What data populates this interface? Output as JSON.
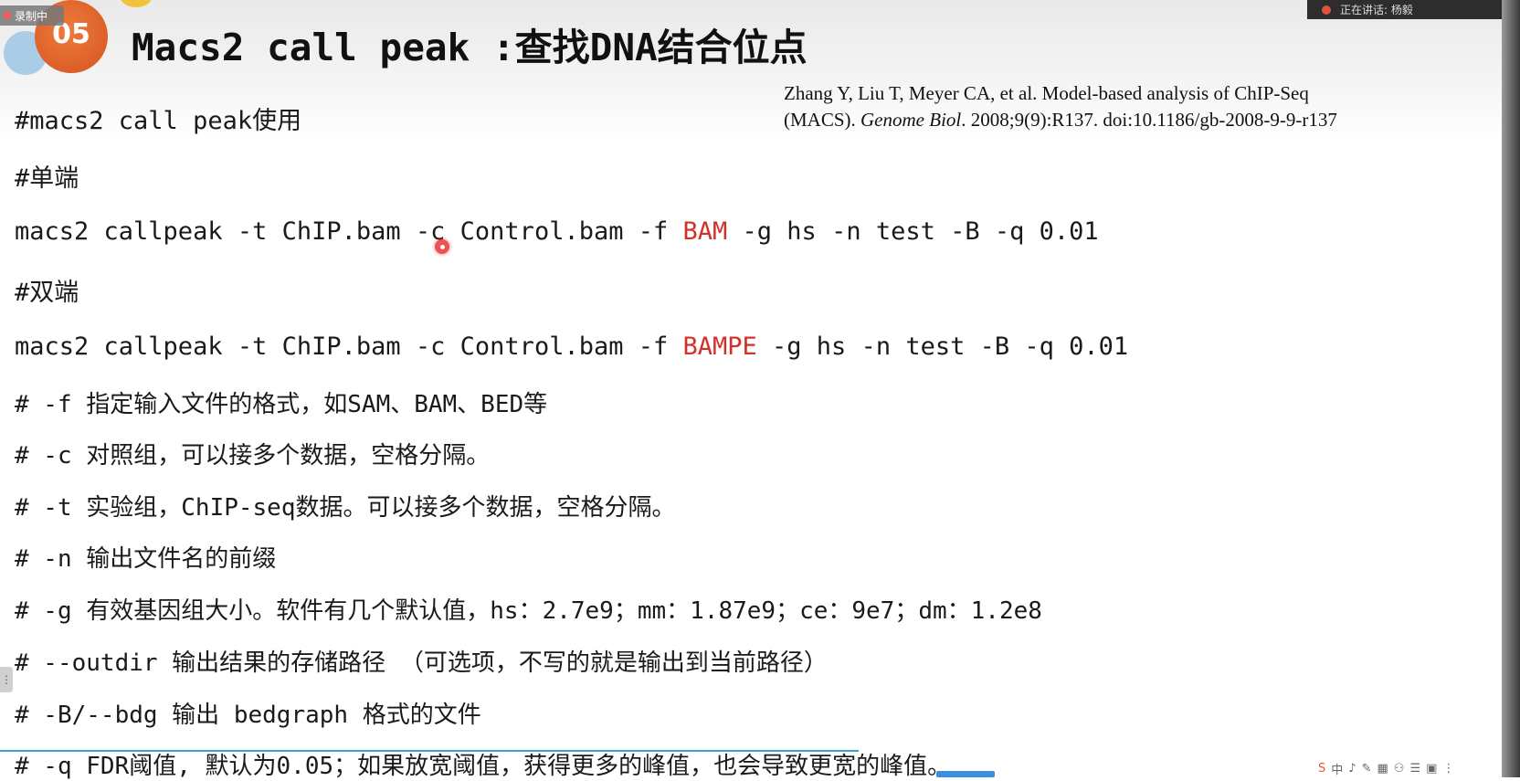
{
  "overlay": {
    "recording_badge": "录制中",
    "speaker_text": "正在讲话: 杨毅"
  },
  "slide": {
    "number": "05",
    "title": "Macs2 call peak :查找DNA结合位点",
    "citation": {
      "line1": "Zhang Y, Liu T, Meyer CA, et al. Model-based analysis of ChIP-Seq",
      "line2_pre": "(MACS). ",
      "journal": "Genome Biol",
      "line2_post": ". 2008;9(9):R137. doi:10.1186/gb-2008-9-9-r137"
    },
    "lines": {
      "usage": "#macs2 call peak使用",
      "single_end": "#单端",
      "cmd1_pre": "macs2 callpeak -t ChIP.bam -c Control.bam -f ",
      "cmd1_format": "BAM",
      "cmd1_post": " -g hs -n test -B -q 0.01",
      "paired_end": "#双端",
      "cmd2_pre": "macs2 callpeak -t ChIP.bam -c Control.bam -f ",
      "cmd2_format": "BAMPE",
      "cmd2_post": " -g hs -n test -B -q 0.01",
      "opt_f": "# -f 指定输入文件的格式，如SAM、BAM、BED等",
      "opt_c": "# -c 对照组，可以接多个数据，空格分隔。",
      "opt_t": "# -t 实验组，ChIP-seq数据。可以接多个数据，空格分隔。",
      "opt_n": "# -n 输出文件名的前缀",
      "opt_g": "# -g 有效基因组大小。软件有几个默认值，hs：2.7e9；mm：1.87e9；ce：9e7；dm：1.2e8",
      "opt_outdir": "# --outdir 输出结果的存储路径 （可选项，不写的就是输出到当前路径）",
      "opt_B": "# -B/--bdg 输出 bedgraph 格式的文件",
      "opt_q": "# -q FDR阈值, 默认为0.05；如果放宽阈值，获得更多的峰值，也会导致更宽的峰值。"
    }
  },
  "tray": {
    "items": [
      "S",
      "中",
      "♪",
      "✎",
      "▦",
      "⚇",
      "☰",
      "▣",
      "⋮"
    ]
  },
  "colors": {
    "accent_orange": "#d4541f",
    "format_red": "#d3302a"
  }
}
